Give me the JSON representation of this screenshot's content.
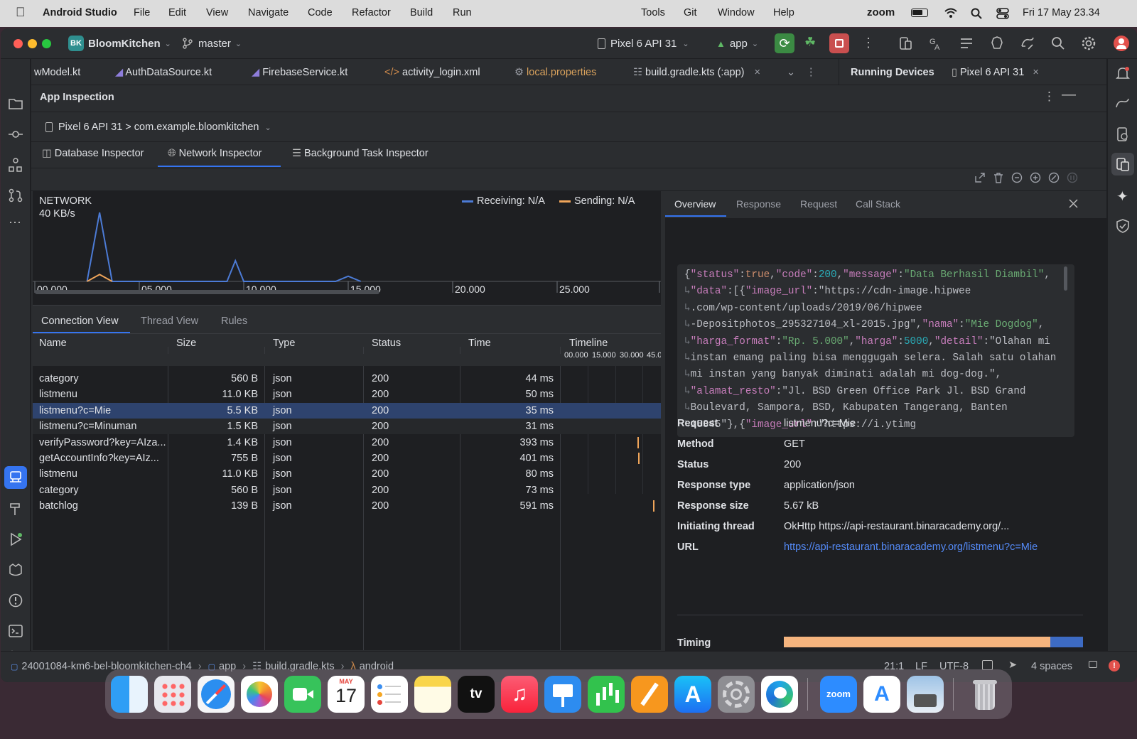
{
  "menubar": {
    "app_name": "Android Studio",
    "items": [
      "File",
      "Edit",
      "View",
      "Navigate",
      "Code",
      "Refactor",
      "Build",
      "Run"
    ],
    "right_items": [
      "Tools",
      "Git",
      "Window",
      "Help"
    ],
    "zoom": "zoom",
    "datetime": "Fri 17 May  23.34"
  },
  "titlebar": {
    "project_badge": "BK",
    "project": "BloomKitchen",
    "branch": "master",
    "device": "Pixel 6 API 31",
    "run_config": "app"
  },
  "editor_tabs": [
    {
      "label": "wModel.kt"
    },
    {
      "label": "AuthDataSource.kt"
    },
    {
      "label": "FirebaseService.kt"
    },
    {
      "label": "activity_login.xml"
    },
    {
      "label": "local.properties"
    },
    {
      "label": "build.gradle.kts (:app)"
    }
  ],
  "running_devices": {
    "title": "Running Devices",
    "device_tab": "Pixel 6 API 31"
  },
  "inspection": {
    "title": "App Inspection",
    "process": "Pixel 6 API 31 > com.example.bloomkitchen",
    "tabs": [
      "Database Inspector",
      "Network Inspector",
      "Background Task Inspector"
    ]
  },
  "network": {
    "title": "NETWORK",
    "scale": "40 KB/s",
    "legend_receiving": "Receiving: N/A",
    "legend_sending": "Sending: N/A",
    "ticks": [
      "00.000",
      "05.000",
      "10.000",
      "15.000",
      "20.000",
      "25.000"
    ]
  },
  "chart_data": {
    "type": "area",
    "title": "NETWORK",
    "xlabel": "",
    "ylabel": "",
    "ylim": [
      0,
      40
    ],
    "x_ticks": [
      "00.000",
      "05.000",
      "10.000",
      "15.000",
      "20.000",
      "25.000"
    ],
    "series": [
      {
        "name": "Receiving",
        "x": [
          2.5,
          3.1,
          3.7,
          9.2,
          9.6,
          10.0,
          14.4,
          15.0,
          15.6
        ],
        "values": [
          0,
          40,
          0,
          0,
          12,
          0,
          0,
          3,
          0
        ]
      },
      {
        "name": "Sending",
        "x": [
          2.5,
          3.1,
          3.7
        ],
        "values": [
          0,
          4,
          0
        ]
      }
    ]
  },
  "conn": {
    "tabs": [
      "Connection View",
      "Thread View",
      "Rules"
    ],
    "headers": [
      "Name",
      "Size",
      "Type",
      "Status",
      "Time",
      "Timeline"
    ],
    "timeline_ticks": [
      "00.000",
      "15.000",
      "30.000",
      "45.0"
    ],
    "rows": [
      {
        "name": "category",
        "size": "560 B",
        "type": "json",
        "status": "200",
        "time": "44 ms"
      },
      {
        "name": "listmenu",
        "size": "11.0 KB",
        "type": "json",
        "status": "200",
        "time": "50 ms"
      },
      {
        "name": "listmenu?c=Mie",
        "size": "5.5 KB",
        "type": "json",
        "status": "200",
        "time": "35 ms"
      },
      {
        "name": "listmenu?c=Minuman",
        "size": "1.5 KB",
        "type": "json",
        "status": "200",
        "time": "31 ms"
      },
      {
        "name": "verifyPassword?key=AIza...",
        "size": "1.4 KB",
        "type": "json",
        "status": "200",
        "time": "393 ms"
      },
      {
        "name": "getAccountInfo?key=AIz...",
        "size": "755 B",
        "type": "json",
        "status": "200",
        "time": "401 ms"
      },
      {
        "name": "listmenu",
        "size": "11.0 KB",
        "type": "json",
        "status": "200",
        "time": "80 ms"
      },
      {
        "name": "category",
        "size": "560 B",
        "type": "json",
        "status": "200",
        "time": "73 ms"
      },
      {
        "name": "batchlog",
        "size": "139 B",
        "type": "json",
        "status": "200",
        "time": "591 ms"
      }
    ]
  },
  "details": {
    "tabs": [
      "Overview",
      "Response",
      "Request",
      "Call Stack"
    ],
    "json_lines": [
      "{\"status\":true,\"code\":200,\"message\":\"Data Berhasil Diambil\",",
      "\"data\":[{\"image_url\":\"https://cdn-image.hipwee",
      ".com/wp-content/uploads/2019/06/hipwee",
      "-Depositphotos_295327104_xl-2015.jpg\",\"nama\":\"Mie Dogdog\",",
      "\"harga_format\":\"Rp. 5.000\",\"harga\":5000,\"detail\":\"Olahan mi",
      "instan emang paling bisa menggugah selera. Salah satu olahan",
      "mi instan yang banyak diminati adalah mi dog-dog.\",",
      "\"alamat_resto\":\"Jl. BSD Green Office Park Jl. BSD Grand",
      "Boulevard, Sampora, BSD, Kabupaten Tangerang, Banten",
      "15345\"},{\"image_url\":\"https://i.ytimg"
    ],
    "fields": [
      {
        "k": "Request",
        "v": "listmenu?c=Mie"
      },
      {
        "k": "Method",
        "v": "GET"
      },
      {
        "k": "Status",
        "v": "200"
      },
      {
        "k": "Response type",
        "v": "application/json"
      },
      {
        "k": "Response size",
        "v": "5.67 kB"
      },
      {
        "k": "Initiating thread",
        "v": "OkHttp https://api-restaurant.binaracademy.org/..."
      },
      {
        "k": "URL",
        "v": "https://api-restaurant.binaracademy.org/listmenu?c=Mie"
      }
    ],
    "timing_label": "Timing",
    "timing_fraction_waiting": 0.89
  },
  "statusbar": {
    "path": [
      "24001084-km6-bel-bloomkitchen-ch4",
      "app",
      "build.gradle.kts",
      "android"
    ],
    "position": "21:1",
    "line_sep": "LF",
    "encoding": "UTF-8",
    "indent": "4 spaces"
  },
  "dock": {
    "calendar_month": "MAY",
    "calendar_day": "17",
    "tv_label": "tv",
    "zoom_label": "zoom"
  },
  "colors": {
    "accent": "#3574f0",
    "receiving": "#4c7bd6",
    "sending": "#f0a55a",
    "selected_row": "#2e436e",
    "link": "#548af7"
  }
}
